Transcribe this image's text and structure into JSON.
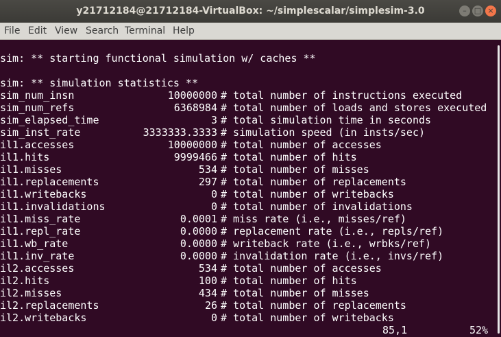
{
  "window": {
    "title": "y21712184@21712184-VirtualBox: ~/simplescalar/simplesim-3.0",
    "minimize_glyph": "–",
    "maximize_glyph": "□",
    "close_glyph": "×"
  },
  "menu": {
    "file": "File",
    "edit": "Edit",
    "view": "View",
    "search": "Search",
    "terminal": "Terminal",
    "help": "Help"
  },
  "terminal": {
    "line_start": "sim: ** starting functional simulation w/ caches **",
    "line_stats": "sim: ** simulation statistics **",
    "stats": [
      {
        "name": "sim_num_insn",
        "value": "10000000",
        "desc": "# total number of instructions executed"
      },
      {
        "name": "sim_num_refs",
        "value": "6368984",
        "desc": "# total number of loads and stores executed"
      },
      {
        "name": "sim_elapsed_time",
        "value": "3",
        "desc": "# total simulation time in seconds"
      },
      {
        "name": "sim_inst_rate",
        "value": "3333333.3333",
        "desc": "# simulation speed (in insts/sec)"
      },
      {
        "name": "il1.accesses",
        "value": "10000000",
        "desc": "# total number of accesses"
      },
      {
        "name": "il1.hits",
        "value": "9999466",
        "desc": "# total number of hits"
      },
      {
        "name": "il1.misses",
        "value": "534",
        "desc": "# total number of misses"
      },
      {
        "name": "il1.replacements",
        "value": "297",
        "desc": "# total number of replacements"
      },
      {
        "name": "il1.writebacks",
        "value": "0",
        "desc": "# total number of writebacks"
      },
      {
        "name": "il1.invalidations",
        "value": "0",
        "desc": "# total number of invalidations"
      },
      {
        "name": "il1.miss_rate",
        "value": "0.0001",
        "desc": "# miss rate (i.e., misses/ref)"
      },
      {
        "name": "il1.repl_rate",
        "value": "0.0000",
        "desc": "# replacement rate (i.e., repls/ref)"
      },
      {
        "name": "il1.wb_rate",
        "value": "0.0000",
        "desc": "# writeback rate (i.e., wrbks/ref)"
      },
      {
        "name": "il1.inv_rate",
        "value": "0.0000",
        "desc": "# invalidation rate (i.e., invs/ref)"
      },
      {
        "name": "il2.accesses",
        "value": "534",
        "desc": "# total number of accesses"
      },
      {
        "name": "il2.hits",
        "value": "100",
        "desc": "# total number of hits"
      },
      {
        "name": "il2.misses",
        "value": "434",
        "desc": "# total number of misses"
      },
      {
        "name": "il2.replacements",
        "value": "26",
        "desc": "# total number of replacements"
      },
      {
        "name": "il2.writebacks",
        "value": "0",
        "desc": "# total number of writebacks"
      }
    ],
    "status_position": "85,1",
    "status_percent": "52%"
  }
}
